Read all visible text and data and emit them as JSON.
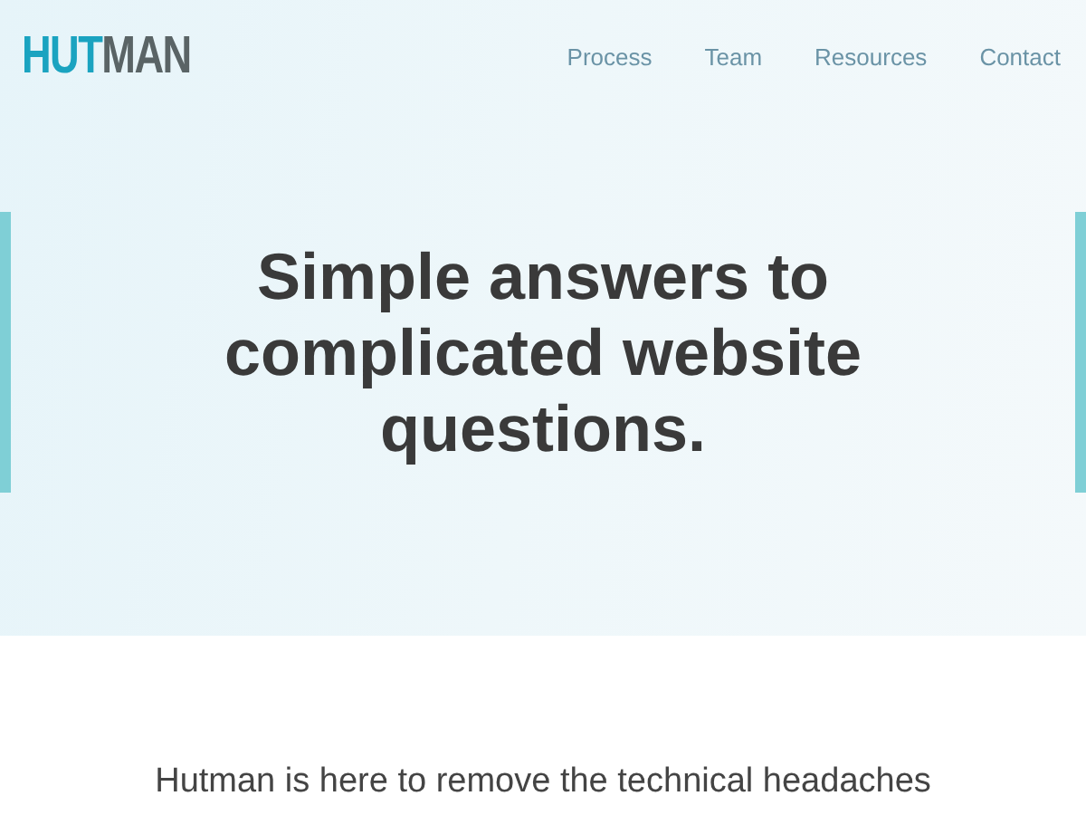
{
  "header": {
    "logo": [
      {
        "text": "HUT",
        "kind": "accent"
      },
      {
        "text": "MAN",
        "kind": "plain"
      }
    ],
    "nav": [
      {
        "label": "Process"
      },
      {
        "label": "Team"
      },
      {
        "label": "Resources"
      },
      {
        "label": "Contact"
      }
    ]
  },
  "hero": {
    "heading": "Simple answers to complicated website questions."
  },
  "intro": {
    "text": "Hutman is here to remove the technical headaches"
  }
}
